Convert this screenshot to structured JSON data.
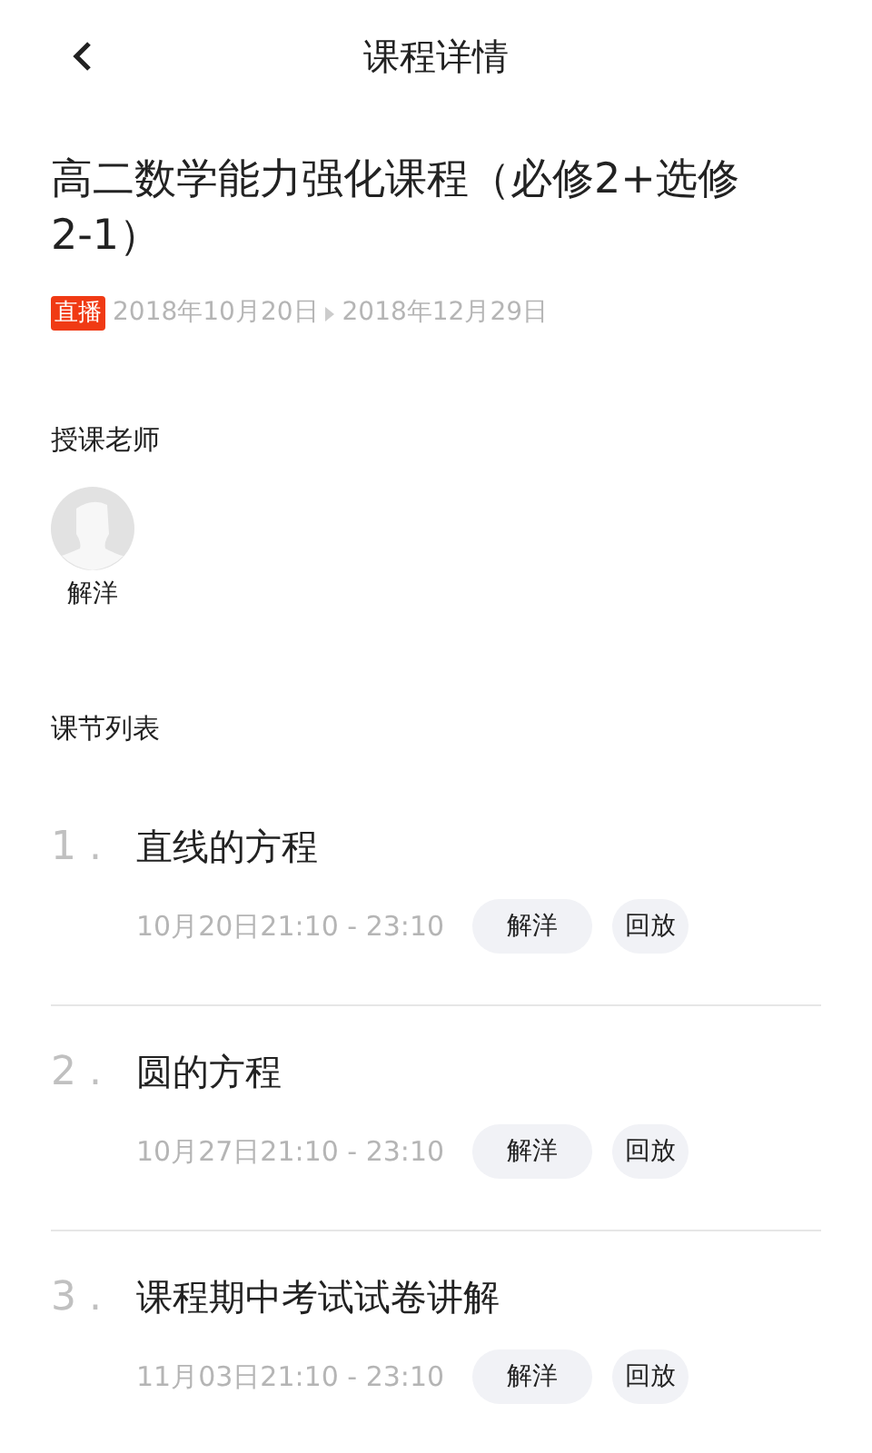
{
  "header": {
    "title": "课程详情"
  },
  "course": {
    "title": "高二数学能力强化课程（必修2+选修2-1）",
    "tag": "直播",
    "start_date": "2018年10月20日",
    "end_date": "2018年12月29日"
  },
  "teachers": {
    "heading": "授课老师",
    "items": [
      {
        "name": "解洋"
      }
    ]
  },
  "lessons": {
    "heading": "课节列表",
    "items": [
      {
        "number": "1 .",
        "title": "直线的方程",
        "time": "10月20日21:10 - 23:10",
        "teacher": "解洋",
        "action": "回放"
      },
      {
        "number": "2 .",
        "title": "圆的方程",
        "time": "10月27日21:10 - 23:10",
        "teacher": "解洋",
        "action": "回放"
      },
      {
        "number": "3 .",
        "title": "课程期中考试试卷讲解",
        "time": "11月03日21:10 - 23:10",
        "teacher": "解洋",
        "action": "回放"
      }
    ]
  }
}
